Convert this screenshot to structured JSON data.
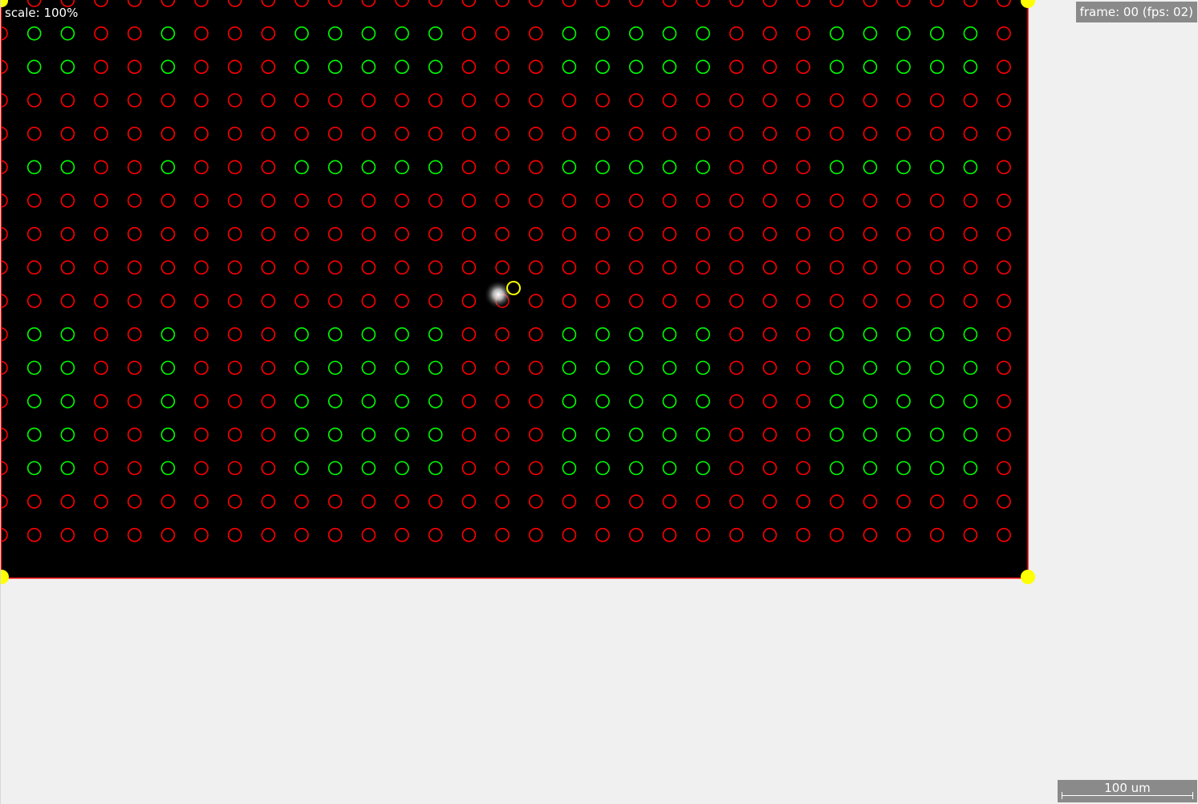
{
  "overlay": {
    "scale_text": "scale: 100%",
    "frame_text": "frame: 00 (fps: 02)",
    "scalebar_text": "100 um"
  },
  "grid": {
    "rows": 17,
    "cols": 31,
    "green_cols": [
      1,
      2,
      5,
      9,
      10,
      11,
      12,
      13,
      17,
      18,
      19,
      20,
      21,
      25,
      26,
      27,
      28,
      29
    ],
    "green_rows": [
      1,
      2,
      5,
      10,
      11,
      12,
      13,
      14
    ]
  },
  "colors": {
    "background": "#f0f0f0",
    "plate": "#000000",
    "plate_border": "#ff0000",
    "well_active": "#00ff00",
    "well_inactive": "#ff0000",
    "corner_handle": "#ffff00",
    "cursor_ring": "#ffff00"
  }
}
